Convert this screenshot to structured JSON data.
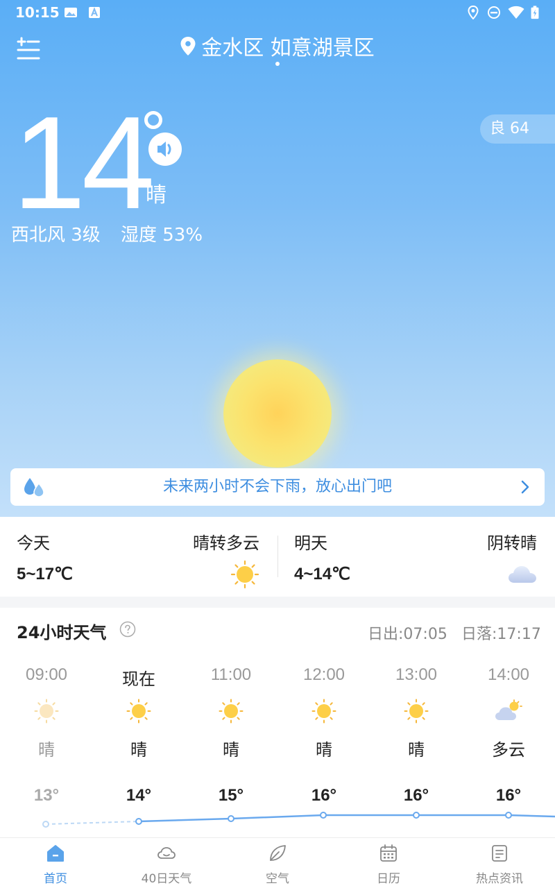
{
  "status_bar": {
    "time": "10:15"
  },
  "header": {
    "location": "金水区 如意湖景区"
  },
  "current": {
    "temperature": "14",
    "condition": "晴",
    "wind": "西北风 3级",
    "humidity": "湿度 53%",
    "aqi": "良 64"
  },
  "rain_notice": {
    "text": "未来两小时不会下雨，放心出门吧"
  },
  "today": {
    "label": "今天",
    "desc": "晴转多云",
    "range": "5~17℃",
    "icon": "sun-icon"
  },
  "tomorrow": {
    "label": "明天",
    "desc": "阴转晴",
    "range": "4~14℃",
    "icon": "cloud-icon"
  },
  "hourly": {
    "title": "24小时天气",
    "sunrise": "日出:07:05",
    "sunset": "日落:17:17",
    "items": [
      {
        "time": "09:00",
        "cond": "晴",
        "temp": "13°",
        "icon": "sun-icon"
      },
      {
        "time": "现在",
        "cond": "晴",
        "temp": "14°",
        "icon": "sun-icon"
      },
      {
        "time": "11:00",
        "cond": "晴",
        "temp": "15°",
        "icon": "sun-icon"
      },
      {
        "time": "12:00",
        "cond": "晴",
        "temp": "16°",
        "icon": "sun-icon"
      },
      {
        "time": "13:00",
        "cond": "晴",
        "temp": "16°",
        "icon": "sun-icon"
      },
      {
        "time": "14:00",
        "cond": "多云",
        "temp": "16°",
        "icon": "partly-cloudy-icon"
      }
    ]
  },
  "nav": [
    {
      "label": "首页",
      "icon": "home-icon",
      "active": true
    },
    {
      "label": "40日天气",
      "icon": "cloud-icon"
    },
    {
      "label": "空气",
      "icon": "leaf-icon"
    },
    {
      "label": "日历",
      "icon": "calendar-icon"
    },
    {
      "label": "热点资讯",
      "icon": "news-icon"
    }
  ],
  "colors": {
    "accent": "#3e8ee0",
    "sky_top": "#5aaef6",
    "sky_bottom": "#c3e0fa"
  }
}
